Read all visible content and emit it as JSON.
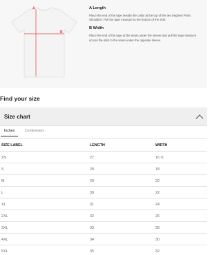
{
  "measurement_guide": {
    "markers": {
      "a": "A",
      "b": "B"
    },
    "length": {
      "title": "A Length",
      "text": "Place the end of the tape beside the collar at the top of the tee (Highest Point Shoulder). Pull the tape measure to the bottom of the shirt."
    },
    "width": {
      "title": "B Width",
      "text": "Place the end of the tape at the seam under the sleeve and pull the tape measure across the shirt to the seam under the opposite sleeve."
    }
  },
  "find_your_size": "Find your size",
  "size_chart": {
    "title": "Size chart",
    "tabs": {
      "inches": "Inches",
      "centimeters": "Centimeters"
    },
    "headers": {
      "size": "SIZE LABEL",
      "length": "LENGTH",
      "width": "WIDTH"
    },
    "rows": [
      {
        "size": "XS",
        "length": "27",
        "width": "16 ½"
      },
      {
        "size": "S",
        "length": "28",
        "width": "18"
      },
      {
        "size": "M",
        "length": "29",
        "width": "20"
      },
      {
        "size": "L",
        "length": "30",
        "width": "22"
      },
      {
        "size": "XL",
        "length": "31",
        "width": "24"
      },
      {
        "size": "2XL",
        "length": "32",
        "width": "26"
      },
      {
        "size": "3XL",
        "length": "33",
        "width": "28"
      },
      {
        "size": "4XL",
        "length": "34",
        "width": "30"
      },
      {
        "size": "5XL",
        "length": "35",
        "width": "32"
      }
    ]
  },
  "colors": {
    "marker": "#e0453a",
    "header_bg": "#efefef",
    "guide_bg": "#f7f7f7"
  }
}
